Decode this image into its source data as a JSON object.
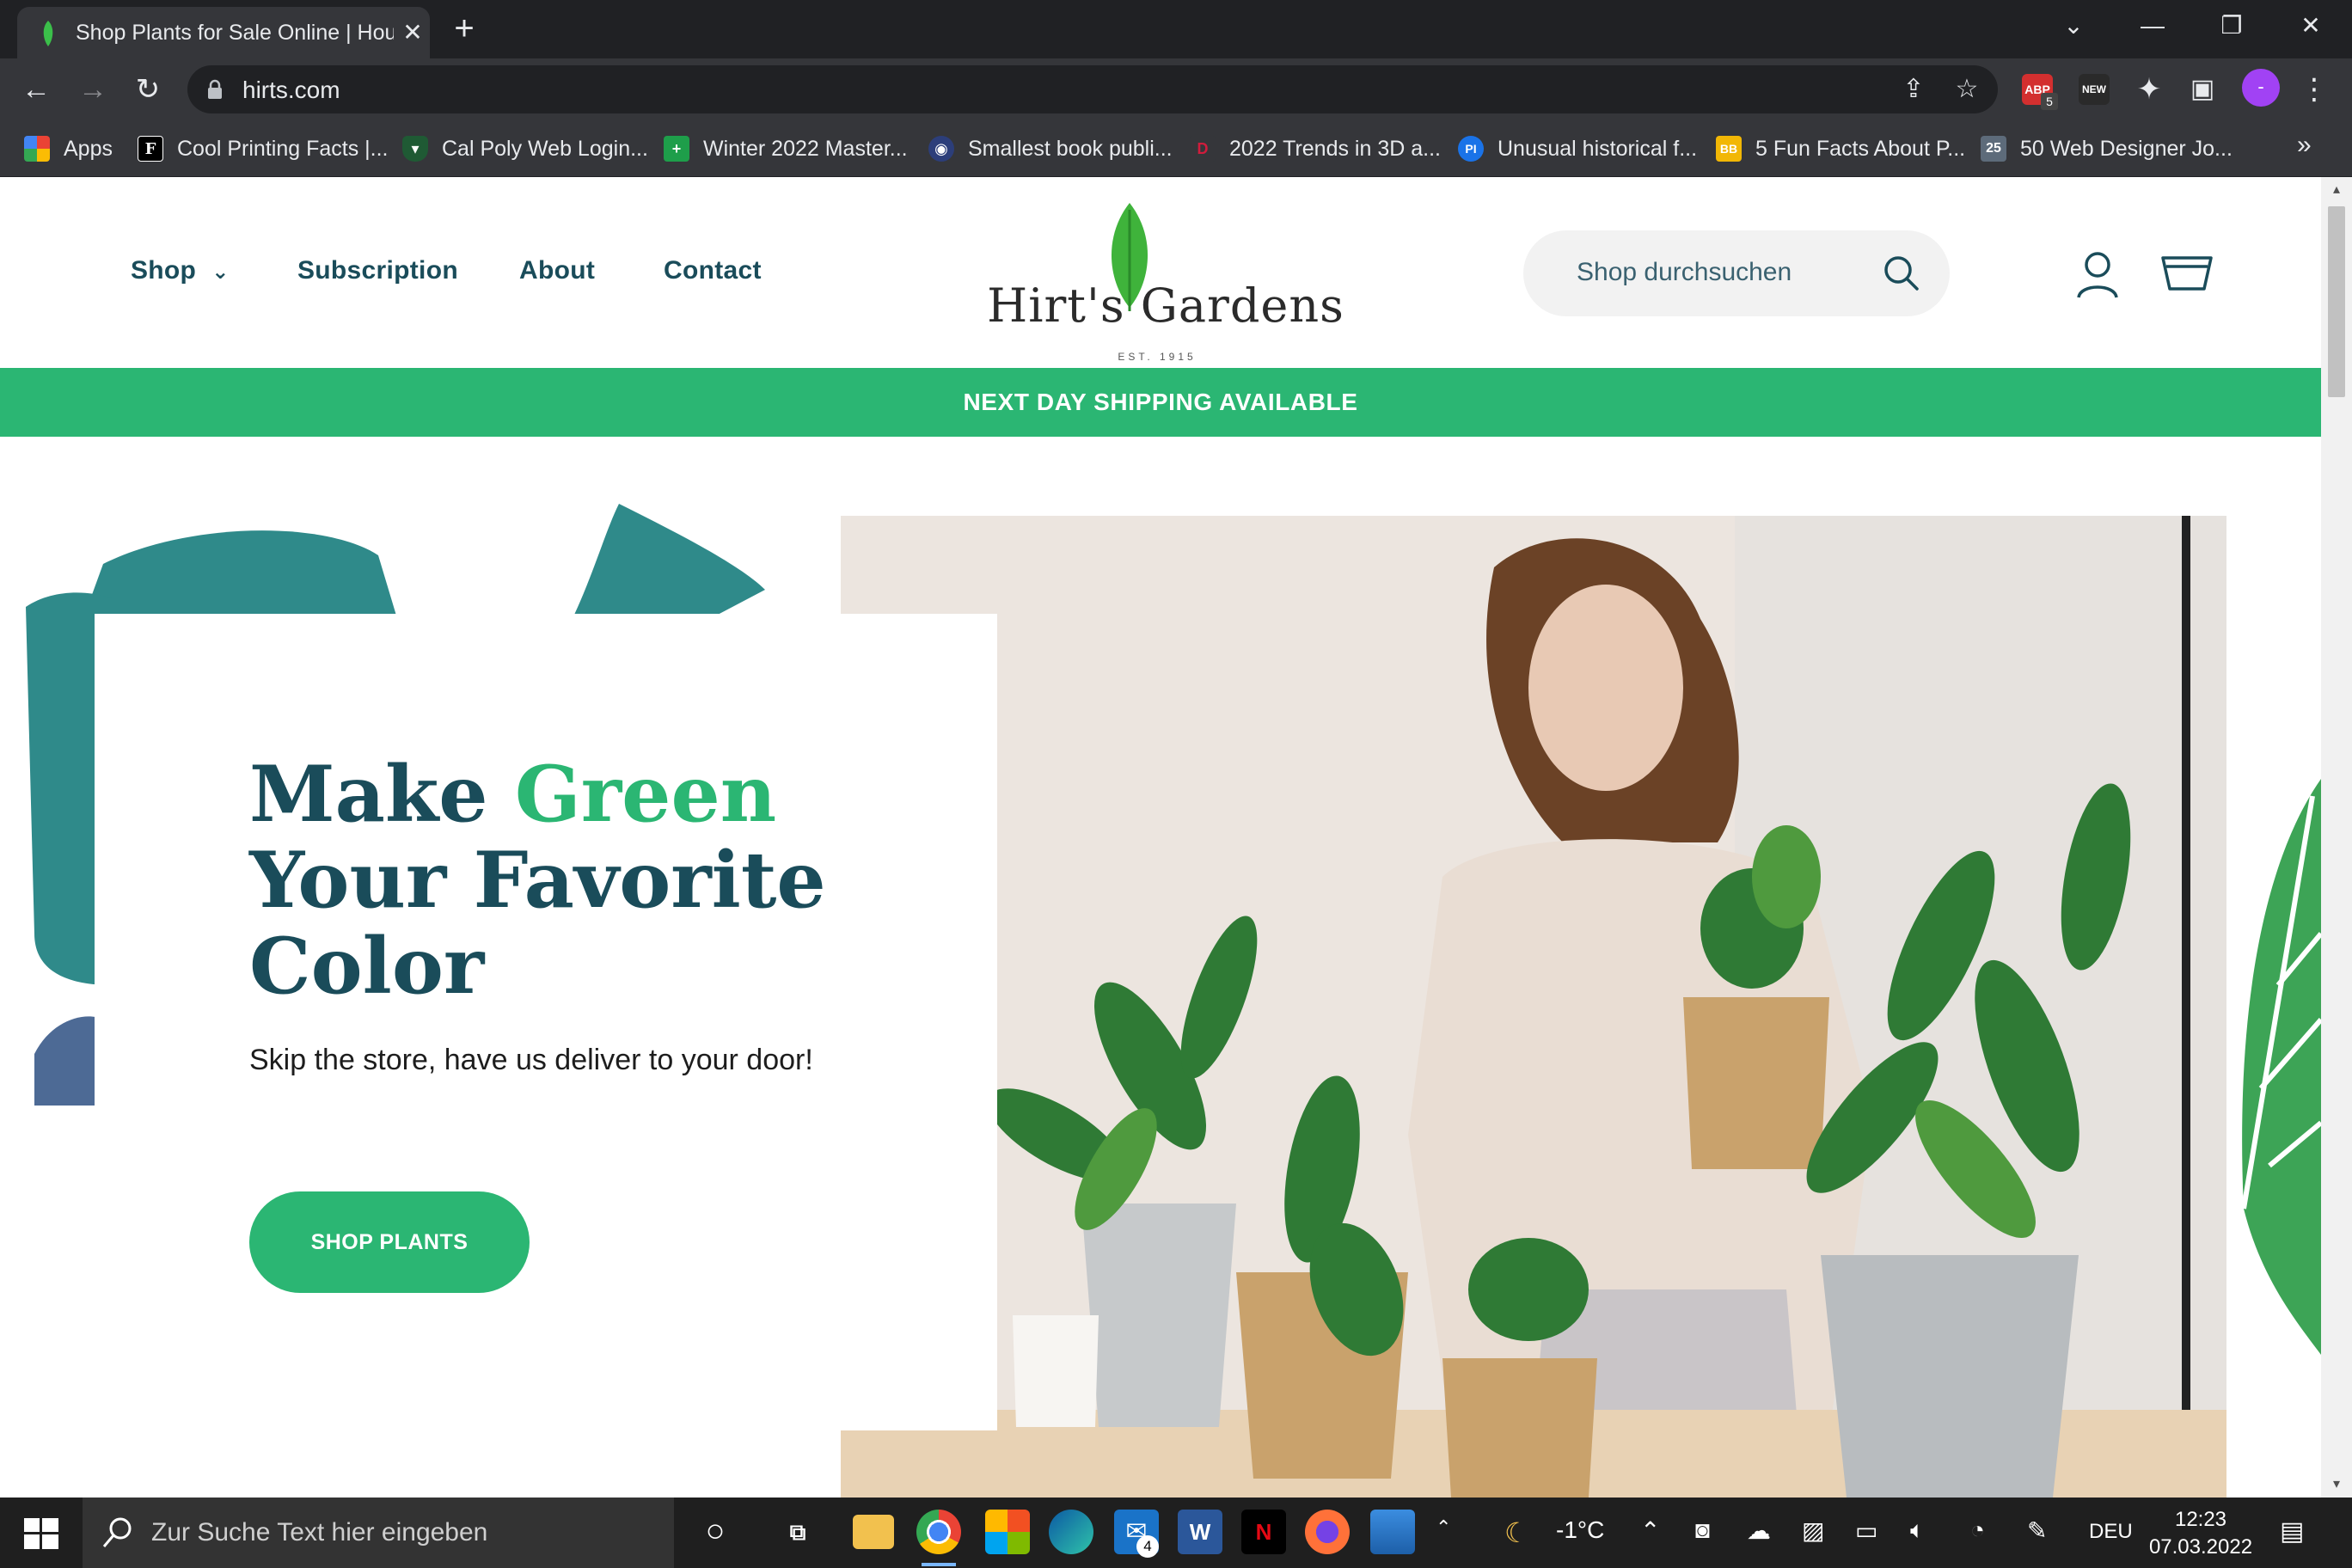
{
  "browser": {
    "tab_title": "Shop Plants for Sale Online | House Plants",
    "new_tab_label": "+",
    "url": "hirts.com",
    "extensions": [
      "ABP",
      "NEW"
    ],
    "abp_count": "5",
    "profile_initial": "-"
  },
  "bookmarks": [
    {
      "label": "Apps",
      "icon": "apps-grid-icon"
    },
    {
      "label": "Cool Printing Facts |...",
      "icon": "F"
    },
    {
      "label": "Cal Poly Web Login...",
      "icon": "shield"
    },
    {
      "label": "Winter 2022 Master...",
      "icon": "plus"
    },
    {
      "label": "Smallest book publi...",
      "icon": "globe"
    },
    {
      "label": "2022 Trends in 3D a...",
      "icon": "D"
    },
    {
      "label": "Unusual historical f...",
      "icon": "PI"
    },
    {
      "label": "5 Fun Facts About P...",
      "icon": "BB"
    },
    {
      "label": "50 Web Designer Jo...",
      "icon": "25"
    }
  ],
  "bookmarks_more": "»",
  "site": {
    "nav": {
      "shop": "Shop",
      "subscription": "Subscription",
      "about": "About",
      "contact": "Contact"
    },
    "logo_name": "Hirt's Gardens",
    "logo_est": "EST. 1915",
    "search_placeholder": "Shop durchsuchen",
    "banner": "NEXT DAY SHIPPING AVAILABLE",
    "hero": {
      "title_part1": "Make ",
      "title_accent": "Green",
      "title_part2": "Your Favorite Color",
      "subtitle": "Skip the store, have us deliver to your door!",
      "cta": "SHOP PLANTS"
    }
  },
  "colors": {
    "brand_green": "#2bb673",
    "brand_teal": "#1a4c5a",
    "leaf_teal": "#2f8a8a"
  },
  "taskbar": {
    "search_placeholder": "Zur Suche Text hier eingeben",
    "mail_badge": "4",
    "weather": "-1°C",
    "language": "DEU",
    "time": "12:23",
    "date": "07.03.2022"
  }
}
